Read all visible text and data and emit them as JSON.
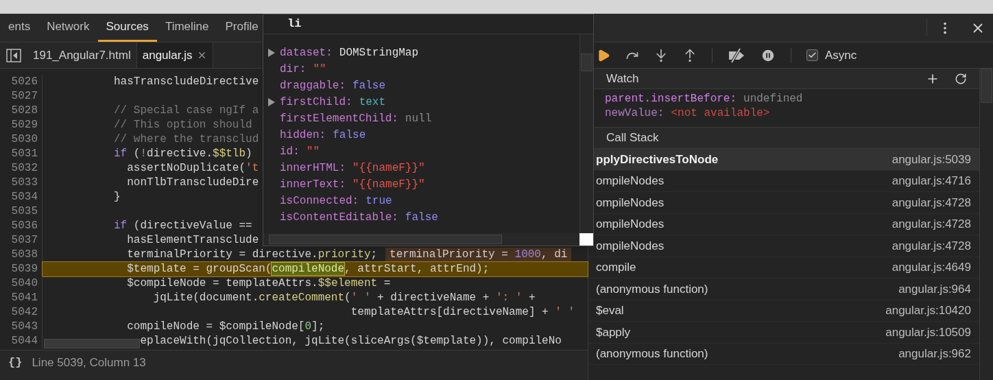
{
  "main_tabs": [
    {
      "label": "ents",
      "selected": false
    },
    {
      "label": "Network",
      "selected": false
    },
    {
      "label": "Sources",
      "selected": true
    },
    {
      "label": "Timeline",
      "selected": false
    },
    {
      "label": "Profile",
      "selected": false
    }
  ],
  "file_tabs": [
    {
      "label": "191_Angular7.html",
      "selected": false,
      "closable": false
    },
    {
      "label": "angular.js",
      "selected": true,
      "closable": true
    }
  ],
  "code": {
    "lines": [
      {
        "number": "5026",
        "highlighted": false,
        "tokens": [
          {
            "t": "          hasTranscludeDirective",
            "kind": "plain"
          }
        ]
      },
      {
        "number": "5027",
        "highlighted": false
      },
      {
        "number": "5028",
        "highlighted": false,
        "tokens": [
          {
            "t": "          // Special case ngIf a",
            "kind": "comment"
          }
        ]
      },
      {
        "number": "5029",
        "highlighted": false,
        "tokens": [
          {
            "t": "          // This option should",
            "kind": "comment"
          }
        ]
      },
      {
        "number": "5030",
        "highlighted": false,
        "tokens": [
          {
            "t": "          // where the transclud",
            "kind": "comment"
          }
        ]
      },
      {
        "number": "5031",
        "highlighted": false,
        "tokens": [
          {
            "t": "          if",
            "kind": "keyword"
          },
          {
            "t": " (",
            "kind": "plain"
          },
          {
            "t": "!",
            "kind": "keyword"
          },
          {
            "t": "directive.",
            "kind": "plain"
          },
          {
            "t": "$$tlb",
            "kind": "prop"
          },
          {
            "t": ")",
            "kind": "plain"
          }
        ]
      },
      {
        "number": "5032",
        "highlighted": false,
        "tokens": [
          {
            "t": "            assertNoDuplicate(",
            "kind": "plain"
          },
          {
            "t": "'t",
            "kind": "string"
          }
        ]
      },
      {
        "number": "5033",
        "highlighted": false,
        "tokens": [
          {
            "t": "            nonTlbTranscludeDire",
            "kind": "plain"
          }
        ]
      },
      {
        "number": "5034",
        "highlighted": false,
        "tokens": [
          {
            "t": "          }",
            "kind": "plain"
          }
        ]
      },
      {
        "number": "5035",
        "highlighted": false
      },
      {
        "number": "5036",
        "highlighted": false,
        "tokens": [
          {
            "t": "          if",
            "kind": "keyword"
          },
          {
            "t": " (directiveValue ==",
            "kind": "plain"
          }
        ]
      },
      {
        "number": "5037",
        "highlighted": false,
        "tokens": [
          {
            "t": "            hasElementTransclude",
            "kind": "plain"
          }
        ]
      },
      {
        "number": "5038",
        "highlighted": false,
        "tokens": [
          {
            "t": "            terminalPriority = directive.",
            "kind": "plain"
          },
          {
            "t": "priority",
            "kind": "prop"
          },
          {
            "t": ";",
            "kind": "plain"
          }
        ],
        "inline_value": [
          {
            "t": "terminalPriority = ",
            "kind": "plain"
          },
          {
            "t": "1000",
            "kind": "keyword"
          },
          {
            "t": ", di",
            "kind": "plain"
          }
        ]
      },
      {
        "number": "5039",
        "highlighted": true,
        "tokens": [
          {
            "t": "            $template = groupScan(",
            "kind": "plain"
          },
          {
            "t": "compileNode",
            "kind": "match"
          },
          {
            "t": ", attrStart, attrEnd);",
            "kind": "plain"
          }
        ]
      },
      {
        "number": "5040",
        "highlighted": false,
        "tokens": [
          {
            "t": "            $compileNode = templateAttrs.",
            "kind": "plain"
          },
          {
            "t": "$$element",
            "kind": "prop"
          },
          {
            "t": " =",
            "kind": "plain"
          }
        ]
      },
      {
        "number": "5041",
        "highlighted": false,
        "tokens": [
          {
            "t": "                jqLite(document.",
            "kind": "plain"
          },
          {
            "t": "createComment",
            "kind": "prop"
          },
          {
            "t": "(",
            "kind": "plain"
          },
          {
            "t": "' '",
            "kind": "string"
          },
          {
            "t": " + directiveName + ",
            "kind": "plain"
          },
          {
            "t": "': '",
            "kind": "string"
          },
          {
            "t": " +",
            "kind": "plain"
          }
        ]
      },
      {
        "number": "5042",
        "highlighted": false,
        "tokens": [
          {
            "t": "                                              templateAttrs[directiveName] + ",
            "kind": "plain"
          },
          {
            "t": "' '",
            "kind": "string"
          }
        ]
      },
      {
        "number": "5043",
        "highlighted": false,
        "tokens": [
          {
            "t": "            compileNode = $compileNode[",
            "kind": "plain"
          },
          {
            "t": "0",
            "kind": "number"
          },
          {
            "t": "];",
            "kind": "plain"
          }
        ]
      },
      {
        "number": "5044",
        "highlighted": false,
        "tokens": [
          {
            "t": "              eplaceWith(jqCollection, jqLite(sliceArgs($template)), compileNo",
            "kind": "plain"
          }
        ]
      }
    ]
  },
  "status_bar": {
    "format_button": "{}",
    "position": "Line 5039, Column 13"
  },
  "popup": {
    "title": "li",
    "properties": [
      {
        "key": "dataset:",
        "value": "DOMStringMap",
        "kind": "object",
        "expandable": true
      },
      {
        "key": "dir:",
        "value": "\"\"",
        "kind": "string",
        "expandable": false
      },
      {
        "key": "draggable:",
        "value": "false",
        "kind": "boolean",
        "expandable": false
      },
      {
        "key": "firstChild:",
        "value": "text",
        "kind": "node",
        "expandable": true
      },
      {
        "key": "firstElementChild:",
        "value": "null",
        "kind": "null",
        "expandable": false
      },
      {
        "key": "hidden:",
        "value": "false",
        "kind": "boolean",
        "expandable": false
      },
      {
        "key": "id:",
        "value": "\"\"",
        "kind": "string",
        "expandable": false
      },
      {
        "key": "innerHTML:",
        "value": "\"{{nameF}}\"",
        "kind": "string",
        "expandable": false
      },
      {
        "key": "innerText:",
        "value": "\"{{nameF}}\"",
        "kind": "string",
        "expandable": false
      },
      {
        "key": "isConnected:",
        "value": "true",
        "kind": "boolean",
        "expandable": false
      },
      {
        "key": "isContentEditable:",
        "value": "false",
        "kind": "boolean",
        "expandable": false
      }
    ]
  },
  "debugger": {
    "async": {
      "label": "Async",
      "checked": true
    },
    "watch": {
      "title": "Watch",
      "items": [
        {
          "name": "parent.insertBefore:",
          "value": "undefined",
          "kind": "undefined"
        },
        {
          "name": "newValue:",
          "value": "<not available>",
          "kind": "unavailable"
        }
      ]
    },
    "call_stack": {
      "title": "Call Stack",
      "frames": [
        {
          "name": "pplyDirectivesToNode",
          "location": "angular.js:5039",
          "selected": true
        },
        {
          "name": "ompileNodes",
          "location": "angular.js:4716",
          "selected": false
        },
        {
          "name": "ompileNodes",
          "location": "angular.js:4728",
          "selected": false
        },
        {
          "name": "ompileNodes",
          "location": "angular.js:4728",
          "selected": false
        },
        {
          "name": "ompileNodes",
          "location": "angular.js:4728",
          "selected": false
        },
        {
          "name": "compile",
          "location": "angular.js:4649",
          "selected": false
        },
        {
          "name": "(anonymous function)",
          "location": "angular.js:964",
          "selected": false
        },
        {
          "name": "$eval",
          "location": "angular.js:10420",
          "selected": false
        },
        {
          "name": "$apply",
          "location": "angular.js:10509",
          "selected": false
        },
        {
          "name": "(anonymous function)",
          "location": "angular.js:962",
          "selected": false
        }
      ]
    }
  }
}
